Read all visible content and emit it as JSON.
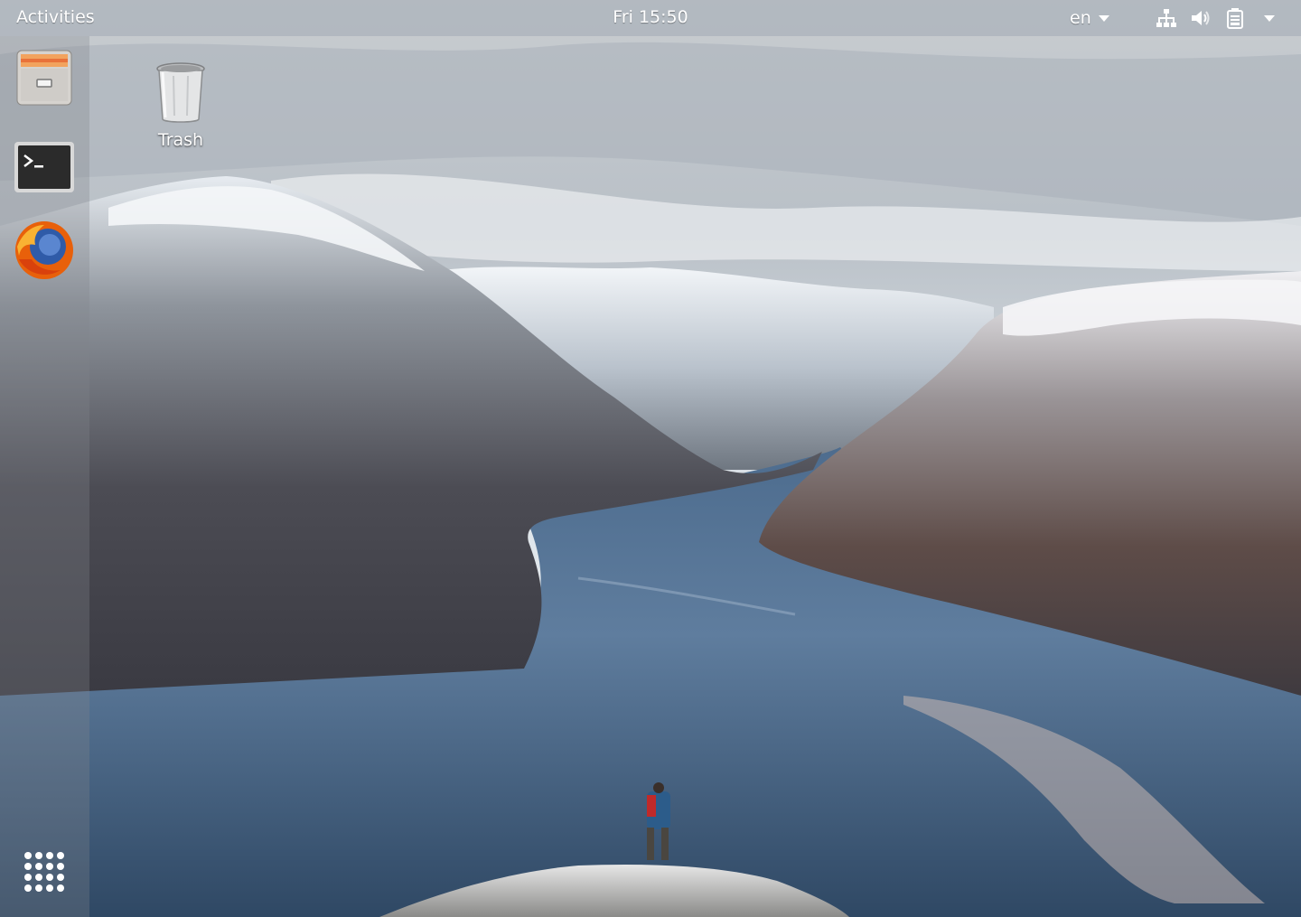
{
  "topbar": {
    "activities_label": "Activities",
    "clock": "Fri 15:50",
    "language": "en",
    "tray_icons": [
      "network-icon",
      "volume-icon",
      "battery-icon",
      "system-menu-caret-icon"
    ]
  },
  "dock": {
    "items": [
      {
        "name": "files",
        "icon": "file-cabinet-icon"
      },
      {
        "name": "terminal",
        "icon": "terminal-icon"
      },
      {
        "name": "firefox",
        "icon": "firefox-icon"
      },
      {
        "name": "show-applications",
        "icon": "app-grid-icon"
      }
    ]
  },
  "desktop": {
    "icons": [
      {
        "label": "Trash",
        "icon": "trash-icon"
      }
    ]
  },
  "colors": {
    "topbar_bg": "#aab2ba",
    "water": "#3e5a78",
    "firefox_orange": "#e8600a",
    "firefox_blue": "#2f5ba8"
  }
}
